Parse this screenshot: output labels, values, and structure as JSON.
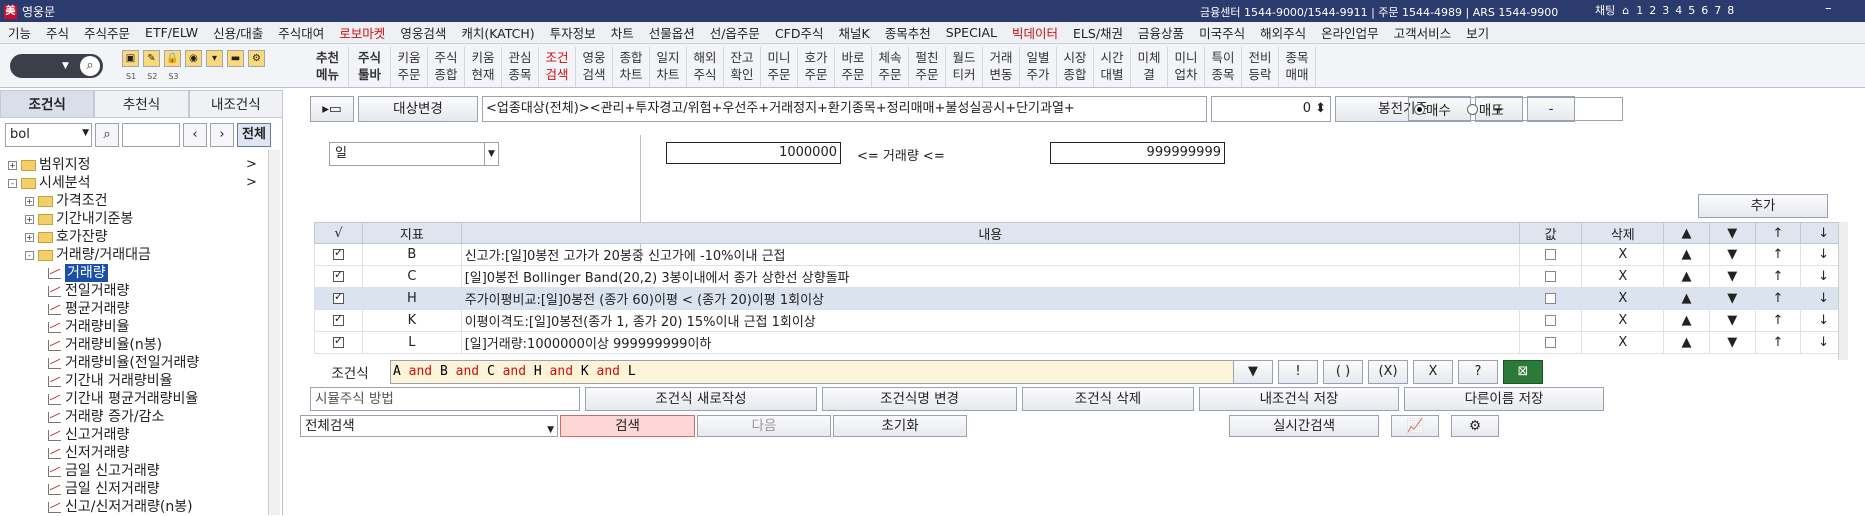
{
  "titlebar": {
    "logo_char": "美",
    "title": "영웅문",
    "info": "금융센터 1544-9000/1544-9911 | 주문 1544-4989 | ARS 1544-9900",
    "chat": "채팅",
    "pages": [
      "1",
      "2",
      "3",
      "4",
      "5",
      "6",
      "7",
      "8"
    ]
  },
  "menu": {
    "items": [
      "기능",
      "주식",
      "주식주문",
      "ETF/ELW",
      "신용/대출",
      "주식대여",
      "로보마켓",
      "영웅검색",
      "캐치(KATCH)",
      "투자정보",
      "차트",
      "선물옵션",
      "선/옵주문",
      "CFD주식",
      "채널K",
      "종목추천",
      "SPECIAL",
      "빅데이터",
      "ELS/채권",
      "금융상품",
      "미국주식",
      "해외주식",
      "온라인업무",
      "고객서비스",
      "보기"
    ],
    "red_items": [
      "로보마켓",
      "빅데이터"
    ]
  },
  "toolbar": {
    "slots": [
      "S1",
      "S2",
      "S3"
    ],
    "buttons": [
      [
        "추천",
        "메뉴"
      ],
      [
        "주식",
        "툴바"
      ],
      [
        "키움",
        "주문"
      ],
      [
        "주식",
        "종합"
      ],
      [
        "키움",
        "현재"
      ],
      [
        "관심",
        "종목"
      ],
      [
        "조건",
        "검색"
      ],
      [
        "영웅",
        "검색"
      ],
      [
        "종합",
        "차트"
      ],
      [
        "일지",
        "차트"
      ],
      [
        "해외",
        "주식"
      ],
      [
        "잔고",
        "확인"
      ],
      [
        "미니",
        "주문"
      ],
      [
        "호가",
        "주문"
      ],
      [
        "바로",
        "주문"
      ],
      [
        "체속",
        "주문"
      ],
      [
        "펄친",
        "주문"
      ],
      [
        "월드",
        "티커"
      ],
      [
        "거래",
        "변동"
      ],
      [
        "일별",
        "주가"
      ],
      [
        "시장",
        "종합"
      ],
      [
        "시간",
        "대별"
      ],
      [
        "미체",
        "결"
      ],
      [
        "미니",
        "업차"
      ],
      [
        "특이",
        "종목"
      ],
      [
        "전비",
        "등락"
      ],
      [
        "종목",
        "매매"
      ]
    ],
    "highlight_index": 6
  },
  "left": {
    "tabs": [
      "조건식",
      "추천식",
      "내조건식"
    ],
    "search_value": "bol",
    "all_label": "전체",
    "tree": [
      {
        "label": "범위지정",
        "level": 0,
        "type": "folder",
        "pm": "+",
        "arrow": true
      },
      {
        "label": "시세분석",
        "level": 0,
        "type": "folder",
        "pm": "-",
        "arrow": true
      },
      {
        "label": "가격조건",
        "level": 1,
        "type": "folder",
        "pm": "+"
      },
      {
        "label": "기간내기준봉",
        "level": 1,
        "type": "folder",
        "pm": "+"
      },
      {
        "label": "호가잔량",
        "level": 1,
        "type": "folder",
        "pm": "+"
      },
      {
        "label": "거래량/거래대금",
        "level": 1,
        "type": "folder",
        "pm": "-"
      },
      {
        "label": "거래량",
        "level": 2,
        "type": "leaf",
        "sel": true
      },
      {
        "label": "전일거래량",
        "level": 2,
        "type": "leaf"
      },
      {
        "label": "평균거래량",
        "level": 2,
        "type": "leaf"
      },
      {
        "label": "거래량비율",
        "level": 2,
        "type": "leaf"
      },
      {
        "label": "거래량비율(n봉)",
        "level": 2,
        "type": "leaf"
      },
      {
        "label": "거래량비율(전일거래량",
        "level": 2,
        "type": "leaf"
      },
      {
        "label": "기간내 거래량비율",
        "level": 2,
        "type": "leaf"
      },
      {
        "label": "기간내 평균거래량비율",
        "level": 2,
        "type": "leaf"
      },
      {
        "label": "거래량 증가/감소",
        "level": 2,
        "type": "leaf"
      },
      {
        "label": "신고거래량",
        "level": 2,
        "type": "leaf"
      },
      {
        "label": "신저거래량",
        "level": 2,
        "type": "leaf"
      },
      {
        "label": "금일 신고거래량",
        "level": 2,
        "type": "leaf"
      },
      {
        "label": "금일 신저거래량",
        "level": 2,
        "type": "leaf"
      },
      {
        "label": "신고/신저거래량(n봉)",
        "level": 2,
        "type": "leaf"
      }
    ]
  },
  "main": {
    "target_btn": "대상변경",
    "condition_text": "<업종대상(전체)><관리+투자경고/위험+우선주+거래정지+환기종목+정리매매+불성실공시+단기과열+",
    "bong_value": "0",
    "bong_label": "봉전기준",
    "plus": "+",
    "minus": "-",
    "radio_buy": "매수",
    "radio_sell": "매도",
    "period_select": "일",
    "vol_min": "1000000",
    "vol_mid": "<= 거래량 <=",
    "vol_max": "999999999",
    "add_btn": "추가"
  },
  "grid": {
    "headers": [
      "√",
      "지표",
      "내용",
      "값",
      "삭제",
      "▲",
      "▼",
      "↑",
      "↓"
    ],
    "rows": [
      {
        "id": "B",
        "content": "신고가:[일]0봉전 고가가 20봉중 신고가에 -10%이내 근접",
        "checked": true
      },
      {
        "id": "C",
        "content": "[일]0봉전 Bollinger Band(20,2) 3봉이내에서 종가 상한선 상향돌파",
        "checked": true
      },
      {
        "id": "H",
        "content": "주가이평비교:[일]0봉전 (종가 60)이평 < (종가 20)이평 1회이상",
        "checked": true,
        "sel": true
      },
      {
        "id": "K",
        "content": "이평이격도:[일]0봉전(종가 1, 종가 20) 15%이내 근접 1회이상",
        "checked": true
      },
      {
        "id": "L",
        "content": "[일]거래량:1000000이상 999999999이하",
        "checked": true
      }
    ],
    "del": "X",
    "up": "▲",
    "down": "▼",
    "top": "↑",
    "bottom": "↓"
  },
  "formula": {
    "label": "조건식",
    "tokens": [
      {
        "t": "A",
        "k": false
      },
      {
        "t": " and ",
        "k": true
      },
      {
        "t": "B",
        "k": false
      },
      {
        "t": " and ",
        "k": true
      },
      {
        "t": "C",
        "k": false
      },
      {
        "t": " and ",
        "k": true
      },
      {
        "t": "H",
        "k": false
      },
      {
        "t": " and ",
        "k": true
      },
      {
        "t": "K",
        "k": false
      },
      {
        "t": " and ",
        "k": true
      },
      {
        "t": "L",
        "k": false
      }
    ],
    "buttons": [
      "▼",
      "!",
      "( )",
      "(X)",
      "X",
      "?"
    ]
  },
  "bottom": {
    "placeholder": "시뮬주식 방법",
    "new": "조건식 새로작성",
    "rename": "조건식명 변경",
    "delete": "조건식 삭제",
    "save": "내조건식 저장",
    "save_as": "다른이름 저장"
  },
  "search": {
    "select": "전체검색",
    "search": "검색",
    "next": "다음",
    "reset": "초기화",
    "realtime": "실시간검색"
  }
}
